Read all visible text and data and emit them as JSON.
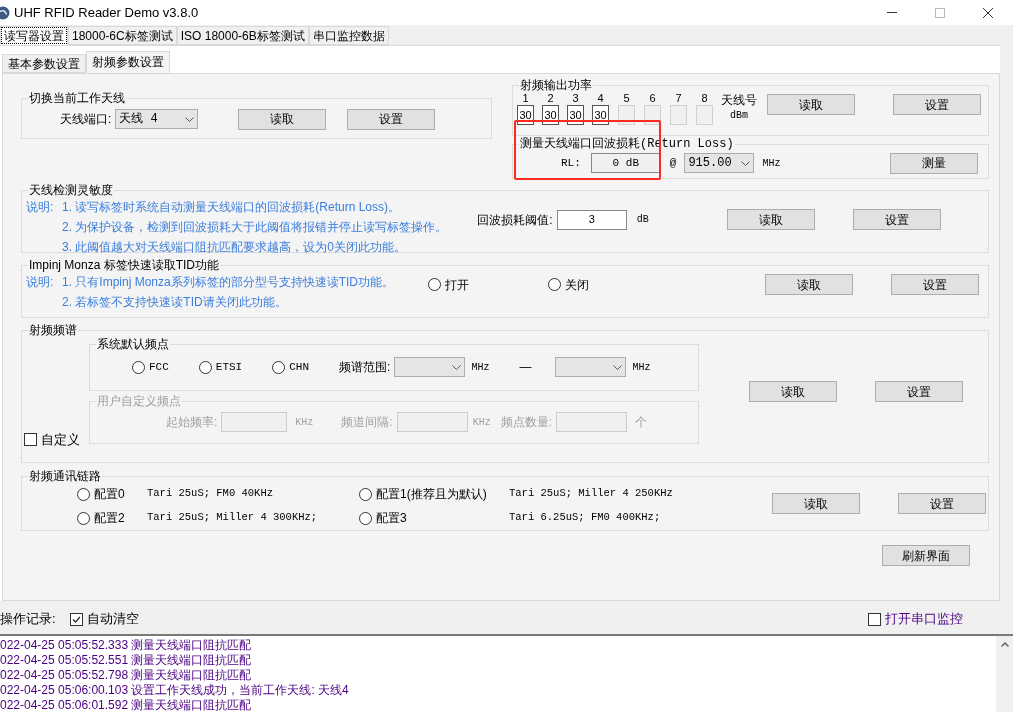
{
  "window": {
    "title": "UHF RFID Reader Demo v3.8.0"
  },
  "tabs": [
    {
      "label": "读写器设置",
      "selected": true
    },
    {
      "label": "18000-6C标签测试",
      "selected": false
    },
    {
      "label": "ISO 18000-6B标签测试",
      "selected": false
    },
    {
      "label": "串口监控数据",
      "selected": false
    }
  ],
  "sub_tabs": [
    {
      "label": "基本参数设置",
      "selected": false
    },
    {
      "label": "射频参数设置",
      "selected": true
    }
  ],
  "antenna_switch": {
    "title": "切换当前工作天线",
    "label": "天线端口:",
    "value": "天线 4",
    "buttons": [
      "读取",
      "设置"
    ]
  },
  "output_power": {
    "title": "射频输出功率",
    "ports": [
      {
        "number": "1",
        "value": "30",
        "enabled": true
      },
      {
        "number": "2",
        "value": "30",
        "enabled": true
      },
      {
        "number": "3",
        "value": "30",
        "enabled": true
      },
      {
        "number": "4",
        "value": "30",
        "enabled": true
      },
      {
        "number": "5",
        "enabled": false
      },
      {
        "number": "6",
        "enabled": false
      },
      {
        "number": "7",
        "enabled": false
      },
      {
        "number": "8",
        "enabled": false
      }
    ],
    "port_label": "天线号",
    "unit": "dBm",
    "buttons": [
      "读取",
      "设置"
    ]
  },
  "return_loss": {
    "title": "测量天线端口回波损耗(Return Loss)",
    "label": "RL:",
    "value": "0 dB",
    "at": "@",
    "frequency": "915.00",
    "unit": "MHz",
    "button": "测量",
    "highlighted": true
  },
  "sensitivity": {
    "title": "天线检测灵敏度",
    "prefix": "说明:",
    "notes": [
      "1. 读写标签时系统自动测量天线端口的回波损耗(Return Loss)。",
      "2. 为保护设备，检测到回波损耗大于此阈值将报错并停止读写标签操作。",
      "3. 此阈值越大对天线端口阻抗匹配要求越高，设为0关闭此功能。"
    ],
    "threshold_label": "回波损耗阈值:",
    "threshold_value": "3",
    "unit": "dB",
    "buttons": [
      "读取",
      "设置"
    ]
  },
  "impinj": {
    "title": "Impinj Monza 标签快速读取TID功能",
    "prefix": "说明:",
    "notes": [
      "1. 只有Impinj Monza系列标签的部分型号支持快速读TID功能。",
      "2. 若标签不支持快速读TID请关闭此功能。"
    ],
    "options": [
      {
        "label": "打开",
        "selected": false
      },
      {
        "label": "关闭",
        "selected": false
      }
    ],
    "buttons": [
      "读取",
      "设置"
    ]
  },
  "spectrum": {
    "title": "射频频谱",
    "default_group": {
      "title": "系统默认频点",
      "regions": [
        {
          "label": "FCC",
          "selected": false
        },
        {
          "label": "ETSI",
          "selected": false
        },
        {
          "label": "CHN",
          "selected": false
        }
      ],
      "range_label": "频谱范围:",
      "from_unit": "MHz",
      "dash": "—",
      "to_unit": "MHz"
    },
    "custom": {
      "label": "自定义",
      "checked": false
    },
    "user_group": {
      "title": "用户自定义频点",
      "disabled": true,
      "start_label": "起始频率:",
      "start_unit": "KHz",
      "spacing_label": "频道间隔:",
      "spacing_unit": "KHz",
      "count_label": "频点数量:",
      "count_unit": "个"
    },
    "buttons": [
      "读取",
      "设置"
    ]
  },
  "link": {
    "title": "射频通讯链路",
    "profiles": [
      {
        "label": "配置0",
        "detail": "Tari 25uS; FM0 40KHz",
        "selected": false
      },
      {
        "label": "配置1(推荐且为默认)",
        "detail": "Tari 25uS; Miller 4 250KHz",
        "selected": false
      },
      {
        "label": "配置2",
        "detail": "Tari 25uS; Miller 4 300KHz;",
        "selected": false
      },
      {
        "label": "配置3",
        "detail": "Tari 6.25uS; FM0 400KHz;",
        "selected": false
      }
    ],
    "buttons": [
      "读取",
      "设置"
    ]
  },
  "refresh_button": "刷新界面",
  "log": {
    "label": "操作记录:",
    "auto_clear": {
      "label": "自动清空",
      "checked": true
    },
    "serial_monitor": {
      "label": "打开串口监控",
      "checked": false
    },
    "entries": [
      {
        "time": "022-04-25 05:05:52.333",
        "message": "测量天线端口阻抗匹配"
      },
      {
        "time": "022-04-25 05:05:52.551",
        "message": "测量天线端口阻抗匹配"
      },
      {
        "time": "022-04-25 05:05:52.798",
        "message": "测量天线端口阻抗匹配"
      },
      {
        "time": "022-04-25 05:06:00.103",
        "message": "设置工作天线成功，当前工作天线: 天线4"
      },
      {
        "time": "022-04-25 05:06:01.592",
        "message": "测量天线端口阻抗匹配"
      }
    ]
  }
}
